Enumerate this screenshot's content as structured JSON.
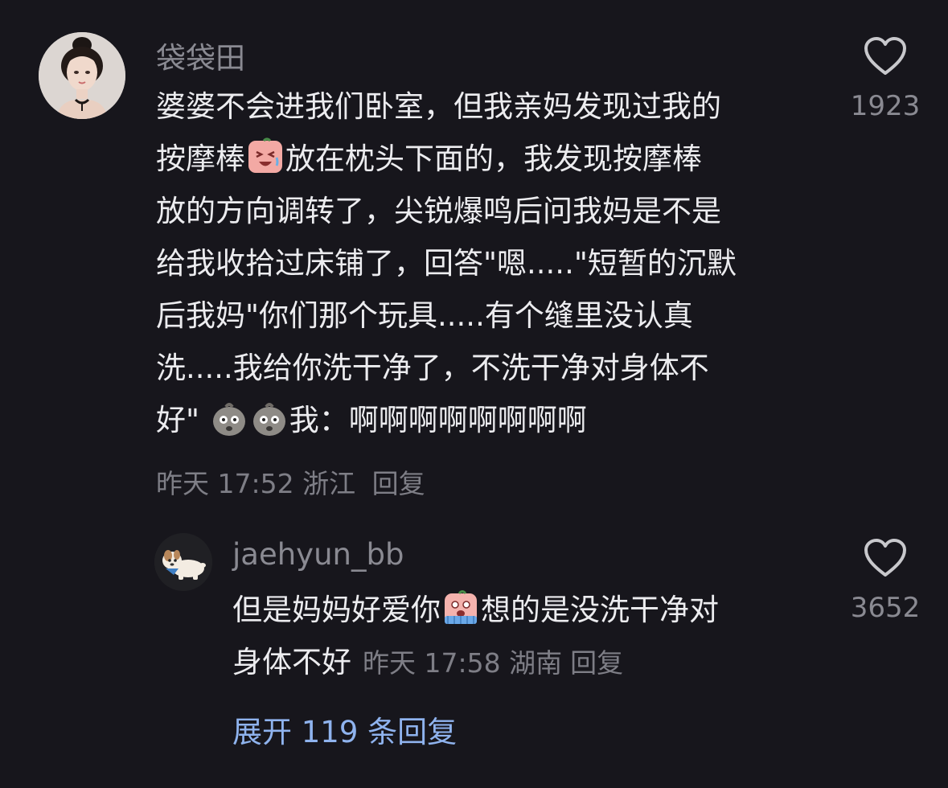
{
  "comment": {
    "username": "袋袋田",
    "text_lines": [
      "婆婆不会进我们卧室，但我亲妈发现过我的",
      "按摩棒",
      "放在枕头下面的，我发现按摩棒",
      "放的方向调转了，尖锐爆鸣后问我妈是不是",
      "给我收拾过床铺了，回答\"嗯.....\"短暂的沉默",
      "后我妈\"你们那个玩具.....有个缝里没认真",
      "洗.....我给你洗干净了，不洗干净对身体不",
      "好\" ",
      "我：啊啊啊啊啊啊啊啊"
    ],
    "emojis": {
      "crying": "crying-face-emoji",
      "shocked": "shocked-potato-emoji"
    },
    "time": "昨天 17:52",
    "location": "浙江",
    "reply_label": "回复",
    "like_count": "1923",
    "like_icon": "heart-outline-icon"
  },
  "reply": {
    "username": "jaehyun_bb",
    "text_lines": [
      "但是妈妈好爱你",
      "想的是没洗干净对",
      "身体不好"
    ],
    "emoji": "scared-face-emoji",
    "time": "昨天 17:58",
    "location": "湖南",
    "reply_label": "回复",
    "like_count": "3652",
    "like_icon": "heart-outline-icon"
  },
  "expand_label": "展开 119 条回复",
  "colors": {
    "background": "#17161c",
    "text": "#ececef",
    "muted": "#7e7e86",
    "link": "#8fb3ee"
  }
}
